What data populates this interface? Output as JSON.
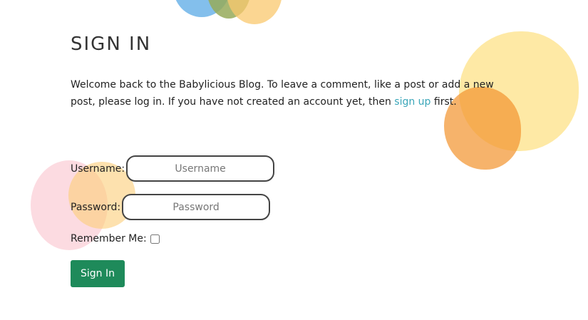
{
  "page": {
    "title": "SIGN IN",
    "intro_text_before_link": "Welcome back to the Babylicious Blog. To leave a comment, like a post or add a new post, please log in. If you have not created an account yet, then ",
    "signup_link_label": "sign up",
    "intro_text_after_link": " first."
  },
  "form": {
    "username_label": "Username:",
    "username_placeholder": "Username",
    "username_value": "",
    "password_label": "Password:",
    "password_placeholder": "Password",
    "password_value": "",
    "remember_label": "Remember Me:",
    "remember_checked": false,
    "submit_label": "Sign In"
  },
  "colors": {
    "link": "#3aa6b9",
    "button_bg": "#1e8a5a",
    "button_text": "#ffffff"
  }
}
